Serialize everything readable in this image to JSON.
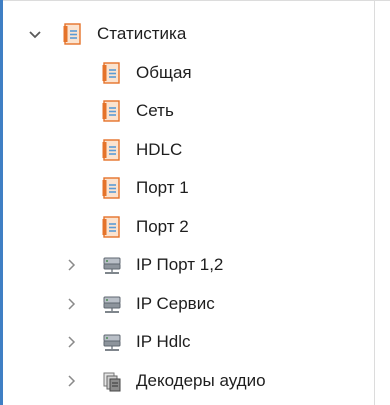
{
  "tree": {
    "root": {
      "label": "Статистика",
      "icon": "report-icon",
      "expanded": true
    },
    "items": [
      {
        "label": "Общая",
        "icon": "report-icon",
        "has_children": false
      },
      {
        "label": "Сеть",
        "icon": "report-icon",
        "has_children": false
      },
      {
        "label": "HDLC",
        "icon": "report-icon",
        "has_children": false
      },
      {
        "label": "Порт 1",
        "icon": "report-icon",
        "has_children": false
      },
      {
        "label": "Порт 2",
        "icon": "report-icon",
        "has_children": false
      },
      {
        "label": "IP Порт 1,2",
        "icon": "network-device-icon",
        "has_children": true,
        "expanded": false
      },
      {
        "label": "IP Сервис",
        "icon": "network-device-icon",
        "has_children": true,
        "expanded": false
      },
      {
        "label": "IP Hdlc",
        "icon": "network-device-icon",
        "has_children": true,
        "expanded": false
      },
      {
        "label": "Декодеры аудио",
        "icon": "stack-icon",
        "has_children": true,
        "expanded": false
      }
    ]
  },
  "colors": {
    "accent_bar": "#3f7fc4",
    "report_icon_orange": "#e5732a",
    "report_icon_blue": "#5b9bd5",
    "chevron": "#7a7a7a"
  }
}
